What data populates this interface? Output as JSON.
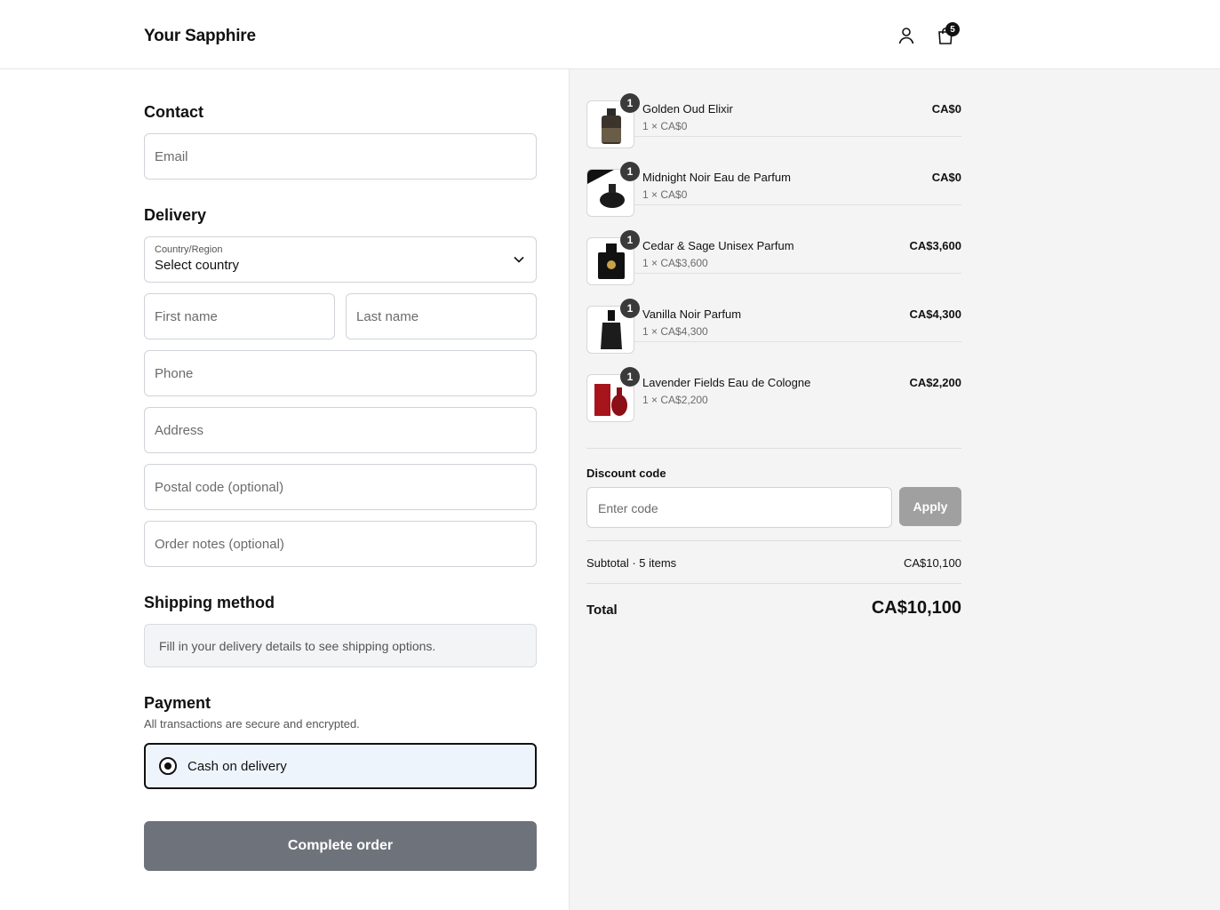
{
  "header": {
    "brand": "Your Sapphire",
    "cart_count": "5"
  },
  "contact": {
    "title": "Contact",
    "email_placeholder": "Email"
  },
  "delivery": {
    "title": "Delivery",
    "country_label": "Country/Region",
    "country_value": "Select country",
    "first_name_placeholder": "First name",
    "last_name_placeholder": "Last name",
    "phone_placeholder": "Phone",
    "address_placeholder": "Address",
    "postal_placeholder": "Postal code (optional)",
    "notes_placeholder": "Order notes (optional)"
  },
  "shipping": {
    "title": "Shipping method",
    "note": "Fill in your delivery details to see shipping options."
  },
  "payment": {
    "title": "Payment",
    "subtitle": "All transactions are secure and encrypted.",
    "option": "Cash on delivery"
  },
  "complete_button": "Complete order",
  "summary": {
    "items": [
      {
        "qty": "1",
        "name": "Golden Oud Elixir",
        "sub": "1 × CA$0",
        "price": "CA$0"
      },
      {
        "qty": "1",
        "name": "Midnight Noir Eau de Parfum",
        "sub": "1 × CA$0",
        "price": "CA$0"
      },
      {
        "qty": "1",
        "name": "Cedar & Sage Unisex Parfum",
        "sub": "1 × CA$3,600",
        "price": "CA$3,600"
      },
      {
        "qty": "1",
        "name": "Vanilla Noir Parfum",
        "sub": "1 × CA$4,300",
        "price": "CA$4,300"
      },
      {
        "qty": "1",
        "name": "Lavender Fields Eau de Cologne",
        "sub": "1 × CA$2,200",
        "price": "CA$2,200"
      }
    ],
    "discount_label": "Discount code",
    "discount_placeholder": "Enter code",
    "apply_label": "Apply",
    "subtotal_label": "Subtotal · 5 items",
    "subtotal_value": "CA$10,100",
    "total_label": "Total",
    "total_value": "CA$10,100"
  },
  "colors": {
    "complete_button": "#6e737b",
    "apply_button": "#a0a0a0",
    "summary_bg": "#f4f4f4",
    "payment_selected_bg": "#eef4fc"
  }
}
